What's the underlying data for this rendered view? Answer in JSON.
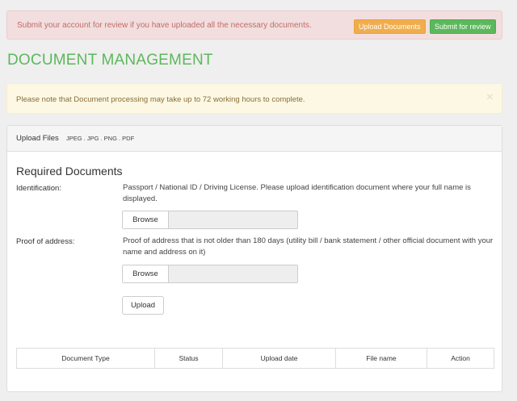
{
  "review_alert": {
    "message": "Submit your account for review if you have uploaded all the necessary documents.",
    "upload_button": "Upload Documents",
    "submit_button": "Submit for review"
  },
  "page_title": "DOCUMENT MANAGEMENT",
  "notice": {
    "message": "Please note that Document processing may take up to 72 working hours to complete.",
    "close_glyph": "×"
  },
  "upload_panel": {
    "title": "Upload Files",
    "formats": "JPEG . JPG . PNG . PDF",
    "section_title": "Required Documents",
    "identification": {
      "label": "Identification:",
      "description": "Passport / National ID / Driving License. Please upload identification document where your full name is displayed.",
      "browse_label": "Browse"
    },
    "proof_of_address": {
      "label": "Proof of address:",
      "description": "Proof of address that is not older than 180 days (utility bill / bank statement / other official document with your name and address on it)",
      "browse_label": "Browse"
    },
    "upload_button": "Upload"
  },
  "documents_table": {
    "columns": [
      "Document Type",
      "Status",
      "Upload date",
      "File name",
      "Action"
    ]
  },
  "colors": {
    "title_green": "#5cb85c",
    "warning_orange": "#f0ad4e",
    "danger_bg": "#f2dede",
    "warning_bg": "#fcf8e3"
  }
}
